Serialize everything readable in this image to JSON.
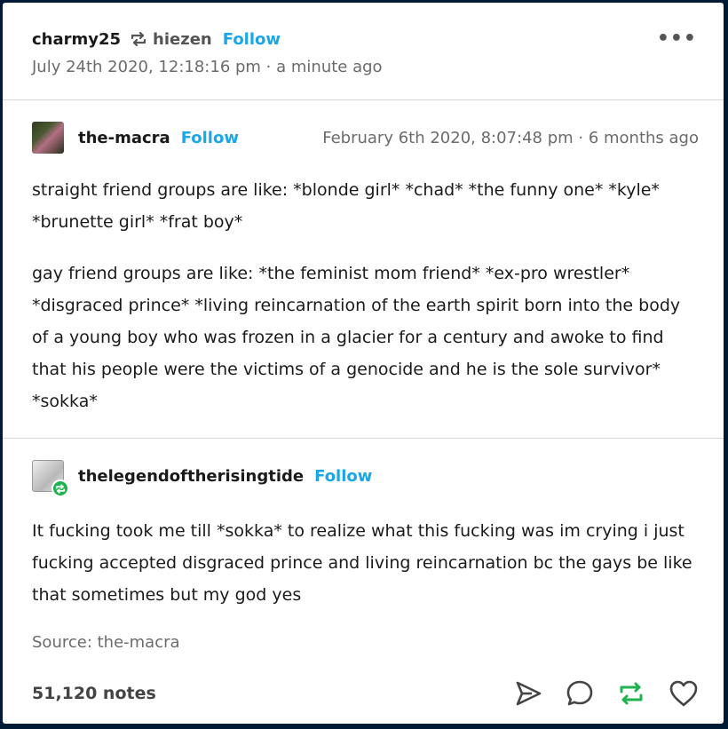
{
  "post": {
    "author": "charmy25",
    "reblogged_from": "hiezen",
    "follow_label": "Follow",
    "timestamp": "July 24th 2020, 12:18:16 pm · a minute ago"
  },
  "trail": [
    {
      "blog": "the-macra",
      "follow_label": "Follow",
      "timestamp": "February 6th 2020, 8:07:48 pm · 6 months ago",
      "paragraphs": [
        "straight friend groups are like: *blonde girl* *chad* *the funny one* *kyle* *brunette girl* *frat boy*",
        "gay friend groups are like: *the feminist mom friend* *ex-pro wrestler* *disgraced prince* *living reincarnation of the earth spirit born into the body of a young boy who was frozen in a glacier for a century and awoke to find that his people were the victims of a genocide and he is the sole survivor* *sokka*"
      ]
    },
    {
      "blog": "thelegendoftherisingtide",
      "follow_label": "Follow",
      "paragraphs": [
        "It fucking took me till *sokka* to realize what this fucking was im crying i just fucking accepted disgraced prince and living reincarnation bc the gays be like that sometimes but my god yes"
      ]
    }
  ],
  "source": "Source: the-macra",
  "notes": "51,120 notes",
  "icons": {
    "reblog_header": "reblog-icon",
    "more": "more-options-icon",
    "share": "share-icon",
    "reply": "reply-icon",
    "reblog": "reblog-icon",
    "like": "heart-icon"
  },
  "colors": {
    "link": "#1ba6e8",
    "reblog_active": "#1fb34f"
  }
}
